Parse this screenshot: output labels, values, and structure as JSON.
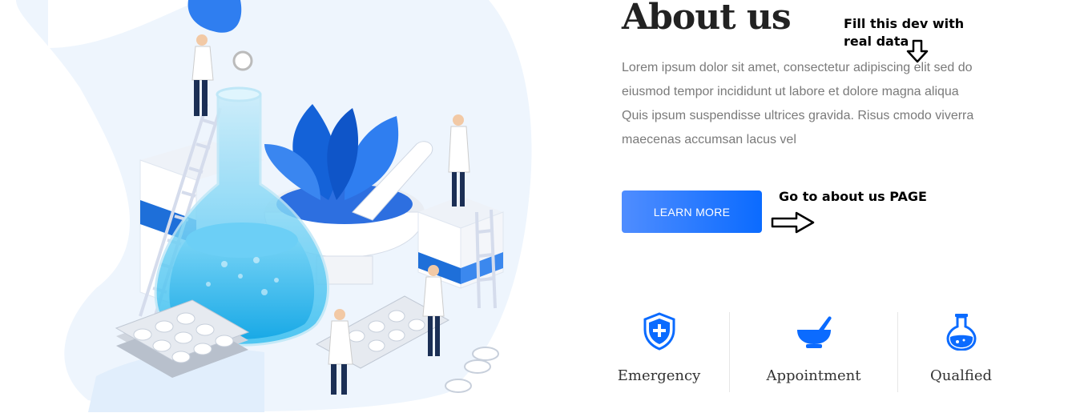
{
  "about": {
    "title": "About us",
    "description": "Lorem ipsum dolor sit amet, consectetur adipiscing elit sed do eiusmod tempor incididunt ut labore et dolore magna aliqua Quis ipsum suspendisse ultrices gravida. Risus cmodo viverra maecenas accumsan lacus vel",
    "button_label": "LEARN MORE"
  },
  "annotations": {
    "fill_note": "Fill this dev with real data",
    "goto_note": "Go to about us PAGE"
  },
  "features": [
    {
      "label": "Emergency",
      "icon": "shield-plus-icon"
    },
    {
      "label": "Appointment",
      "icon": "mortar-pestle-icon"
    },
    {
      "label": "Qualfied",
      "icon": "flask-icon"
    }
  ],
  "colors": {
    "accent": "#0b6bff",
    "accent_light": "#4f8dff",
    "title": "#222222",
    "text": "#7a7a7a"
  }
}
